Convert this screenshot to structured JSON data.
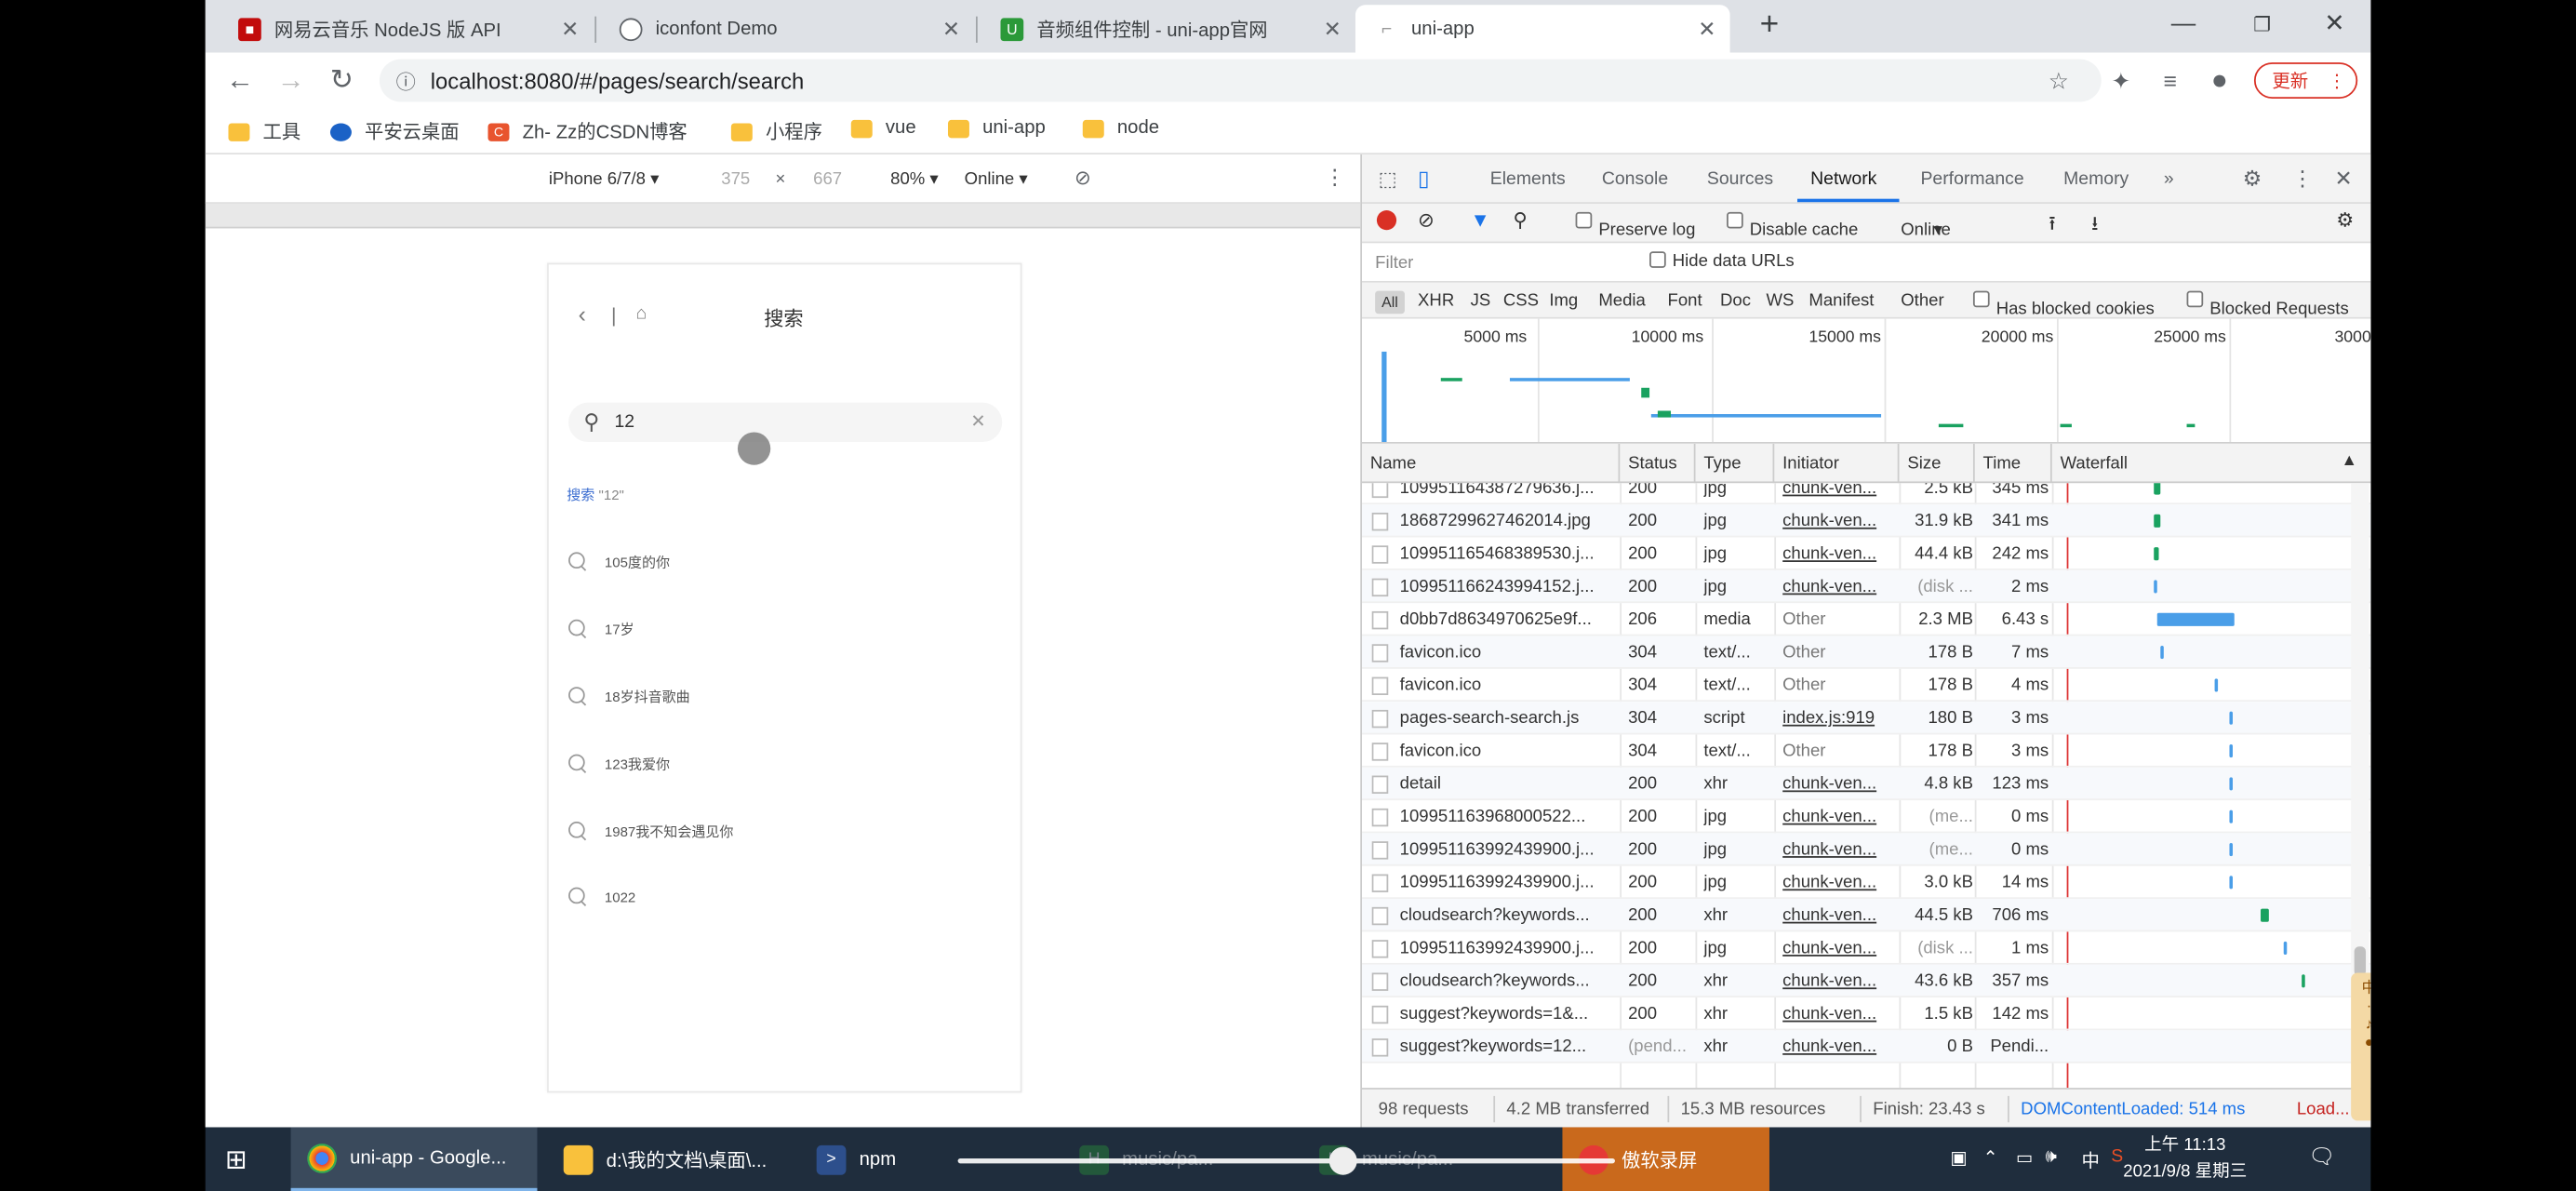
{
  "tabs": [
    {
      "title": "网易云音乐 NodeJS 版 API",
      "favicon": "netease-icon",
      "color": "#c20c0c"
    },
    {
      "title": "iconfont Demo",
      "favicon": "globe-icon",
      "color": "#5f6368"
    },
    {
      "title": "音频组件控制 - uni-app官网",
      "favicon": "uniapp-icon",
      "color": "#2b9939"
    },
    {
      "title": "uni-app",
      "favicon": "uniapp-loading-icon",
      "color": "#999999"
    }
  ],
  "address_bar": {
    "url": "localhost:8080/#/pages/search/search"
  },
  "update_button": "更新",
  "bookmarks": [
    {
      "label": "工具",
      "icon": "folder-icon"
    },
    {
      "label": "平安云桌面",
      "icon": "ping-an-icon"
    },
    {
      "label": "Zh- Zz的CSDN博客",
      "icon": "csdn-icon"
    },
    {
      "label": "小程序",
      "icon": "folder-icon"
    },
    {
      "label": "vue",
      "icon": "folder-icon"
    },
    {
      "label": "uni-app",
      "icon": "folder-icon"
    },
    {
      "label": "node",
      "icon": "folder-icon"
    }
  ],
  "device_toolbar": {
    "device": "iPhone 6/7/8 ▾",
    "width": "375",
    "times": "×",
    "height": "667",
    "zoom": "80% ▾",
    "throttle": "Online ▾"
  },
  "phone": {
    "title": "搜索",
    "search_value": "12",
    "hint_prefix": "搜索",
    "hint_query": "\"12\"",
    "suggestions": [
      "105度的你",
      "17岁",
      "18岁抖音歌曲",
      "123我爱你",
      "1987我不知会遇见你",
      "1022"
    ]
  },
  "devtools": {
    "tabs": [
      "Elements",
      "Console",
      "Sources",
      "Network",
      "Performance",
      "Memory",
      "»"
    ],
    "active_tab": "Network",
    "controls": {
      "preserve_log": "Preserve log",
      "disable_cache": "Disable cache",
      "throttle": "Online"
    },
    "filter_placeholder": "Filter",
    "hide_data_urls": "Hide data URLs",
    "type_filters": [
      "All",
      "XHR",
      "JS",
      "CSS",
      "Img",
      "Media",
      "Font",
      "Doc",
      "WS",
      "Manifest",
      "Other"
    ],
    "has_blocked_cookies": "Has blocked cookies",
    "blocked_requests": "Blocked Requests",
    "overview_labels": [
      "5000 ms",
      "10000 ms",
      "15000 ms",
      "20000 ms",
      "25000 ms",
      "3000"
    ],
    "columns": [
      "Name",
      "Status",
      "Type",
      "Initiator",
      "Size",
      "Time",
      "Waterfall"
    ],
    "requests": [
      {
        "name": "109951164387279636.j...",
        "status": "200",
        "type": "jpg",
        "initiator": "chunk-ven...",
        "size": "2.5 kB",
        "time": "345 ms",
        "wf_start": 0.33,
        "wf_len": 0.02,
        "wf_color": "#1aa260"
      },
      {
        "name": "18687299627462014.jpg",
        "status": "200",
        "type": "jpg",
        "initiator": "chunk-ven...",
        "size": "31.9 kB",
        "time": "341 ms",
        "wf_start": 0.33,
        "wf_len": 0.02,
        "wf_color": "#1aa260"
      },
      {
        "name": "109951165468389530.j...",
        "status": "200",
        "type": "jpg",
        "initiator": "chunk-ven...",
        "size": "44.4 kB",
        "time": "242 ms",
        "wf_start": 0.33,
        "wf_len": 0.015,
        "wf_color": "#1aa260"
      },
      {
        "name": "109951166243994152.j...",
        "status": "200",
        "type": "jpg",
        "initiator": "chunk-ven...",
        "size": "(disk ...",
        "time": "2 ms",
        "wf_start": 0.33,
        "wf_len": 0.01,
        "wf_color": "#4a9ee8"
      },
      {
        "name": "d0bb7d8634970625e9f...",
        "status": "206",
        "type": "media",
        "initiator": "Other",
        "size": "2.3 MB",
        "time": "6.43 s",
        "wf_start": 0.34,
        "wf_len": 0.27,
        "wf_color": "#4a9ee8"
      },
      {
        "name": "favicon.ico",
        "status": "304",
        "type": "text/...",
        "initiator": "Other",
        "size": "178 B",
        "time": "7 ms",
        "wf_start": 0.35,
        "wf_len": 0.01,
        "wf_color": "#4a9ee8"
      },
      {
        "name": "favicon.ico",
        "status": "304",
        "type": "text/...",
        "initiator": "Other",
        "size": "178 B",
        "time": "4 ms",
        "wf_start": 0.54,
        "wf_len": 0.01,
        "wf_color": "#4a9ee8"
      },
      {
        "name": "pages-search-search.js",
        "status": "304",
        "type": "script",
        "initiator": "index.js:919",
        "size": "180 B",
        "time": "3 ms",
        "wf_start": 0.59,
        "wf_len": 0.01,
        "wf_color": "#4a9ee8"
      },
      {
        "name": "favicon.ico",
        "status": "304",
        "type": "text/...",
        "initiator": "Other",
        "size": "178 B",
        "time": "3 ms",
        "wf_start": 0.59,
        "wf_len": 0.01,
        "wf_color": "#4a9ee8"
      },
      {
        "name": "detail",
        "status": "200",
        "type": "xhr",
        "initiator": "chunk-ven...",
        "size": "4.8 kB",
        "time": "123 ms",
        "wf_start": 0.59,
        "wf_len": 0.01,
        "wf_color": "#4a9ee8"
      },
      {
        "name": "109951163968000522...",
        "status": "200",
        "type": "jpg",
        "initiator": "chunk-ven...",
        "size": "(me...",
        "time": "0 ms",
        "wf_start": 0.59,
        "wf_len": 0.01,
        "wf_color": "#4a9ee8"
      },
      {
        "name": "109951163992439900.j...",
        "status": "200",
        "type": "jpg",
        "initiator": "chunk-ven...",
        "size": "(me...",
        "time": "0 ms",
        "wf_start": 0.59,
        "wf_len": 0.01,
        "wf_color": "#4a9ee8"
      },
      {
        "name": "109951163992439900.j...",
        "status": "200",
        "type": "jpg",
        "initiator": "chunk-ven...",
        "size": "3.0 kB",
        "time": "14 ms",
        "wf_start": 0.59,
        "wf_len": 0.01,
        "wf_color": "#4a9ee8"
      },
      {
        "name": "cloudsearch?keywords...",
        "status": "200",
        "type": "xhr",
        "initiator": "chunk-ven...",
        "size": "44.5 kB",
        "time": "706 ms",
        "wf_start": 0.7,
        "wf_len": 0.03,
        "wf_color": "#1aa260"
      },
      {
        "name": "109951163992439900.j...",
        "status": "200",
        "type": "jpg",
        "initiator": "chunk-ven...",
        "size": "(disk ...",
        "time": "1 ms",
        "wf_start": 0.78,
        "wf_len": 0.01,
        "wf_color": "#4a9ee8"
      },
      {
        "name": "cloudsearch?keywords...",
        "status": "200",
        "type": "xhr",
        "initiator": "chunk-ven...",
        "size": "43.6 kB",
        "time": "357 ms",
        "wf_start": 0.84,
        "wf_len": 0.015,
        "wf_color": "#1aa260"
      },
      {
        "name": "suggest?keywords=1&...",
        "status": "200",
        "type": "xhr",
        "initiator": "chunk-ven...",
        "size": "1.5 kB",
        "time": "142 ms",
        "wf_start": 0.0,
        "wf_len": 0.0,
        "wf_color": "#1aa260"
      },
      {
        "name": "suggest?keywords=12...",
        "status": "(pend...",
        "type": "xhr",
        "initiator": "chunk-ven...",
        "size": "0 B",
        "time": "Pendi...",
        "wf_start": 0.0,
        "wf_len": 0.0,
        "wf_color": "#1aa260"
      }
    ],
    "status_bar": {
      "requests": "98 requests",
      "transferred": "4.2 MB transferred",
      "resources": "15.3 MB resources",
      "finish": "Finish: 23.43 s",
      "dom_loaded": "DOMContentLoaded: 514 ms",
      "load": "Load..."
    }
  },
  "taskbar": {
    "items": [
      {
        "label": "uni-app - Google...",
        "icon": "chrome-icon"
      },
      {
        "label": "d:\\我的文档\\桌面\\...",
        "icon": "folder-icon"
      },
      {
        "label": "npm",
        "icon": "powershell-icon"
      },
      {
        "label": "music/pa...",
        "icon": "hbuilder-icon"
      },
      {
        "label": "music/pa...",
        "icon": "hbuilder-icon"
      },
      {
        "label": "傲软录屏",
        "icon": "recorder-icon"
      }
    ],
    "tray_ime": "中",
    "time": "上午 11:13",
    "date": "2021/9/8 星期三"
  }
}
